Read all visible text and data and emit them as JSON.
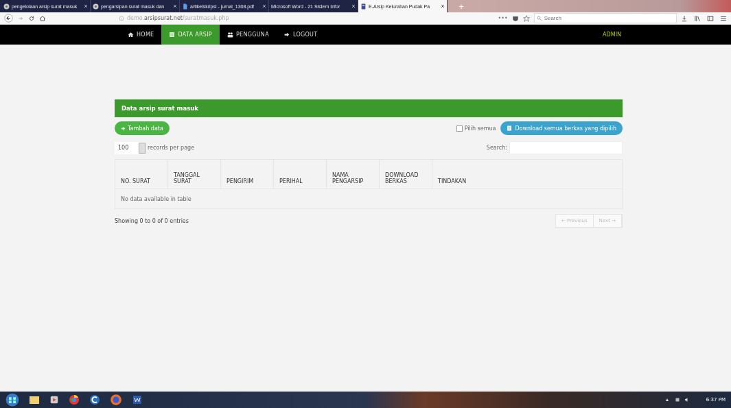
{
  "browser": {
    "tabs": [
      {
        "title": "pengelolaan arsip surat masuk",
        "selected": false
      },
      {
        "title": "pengarsipan surat masuk dan",
        "selected": false
      },
      {
        "title": "artikelskripsi - jurnal_1308.pdf",
        "selected": false
      },
      {
        "title": "Microsoft Word - 21 Sistem Infor",
        "selected": false
      },
      {
        "title": "E-Arsip Kelurahan Pudak Pa",
        "selected": true
      }
    ],
    "new_tab": "+",
    "url": {
      "prefix": "demo.",
      "domain": "arsipsurat.net",
      "path": "/suratmasuk.php"
    },
    "page_actions": "•••",
    "search": {
      "placeholder": "Search"
    }
  },
  "nav": {
    "items": [
      {
        "label": "HOME",
        "selected": false
      },
      {
        "label": "DATA ARSIP",
        "selected": true
      },
      {
        "label": "PENGGUNA",
        "selected": false
      },
      {
        "label": "LOGOUT",
        "selected": false
      }
    ],
    "user": "ADMIN"
  },
  "panel": {
    "title": "Data arsip surat masuk",
    "add_button": "Tambah data",
    "select_all": {
      "label": "Pilih semua",
      "checked": false
    },
    "download_button": "Download semua berkas yang dipilih",
    "page_size": "100",
    "page_size_label": "records per page",
    "search_label": "Search:",
    "columns": [
      "NO. SURAT",
      "TANGGAL SURAT",
      "PENGIRIM",
      "PERIHAL",
      "NAMA PENGARSIP",
      "DOWNLOAD BERKAS",
      "TINDAKAN"
    ],
    "empty_message": "No data available in table",
    "info": "Showing 0 to 0 of 0 entries",
    "pagination": [
      {
        "label": "← Previous",
        "disabled": true
      },
      {
        "label": "Next →",
        "disabled": true
      }
    ]
  },
  "taskbar": {
    "clock": "6:37 PM"
  }
}
